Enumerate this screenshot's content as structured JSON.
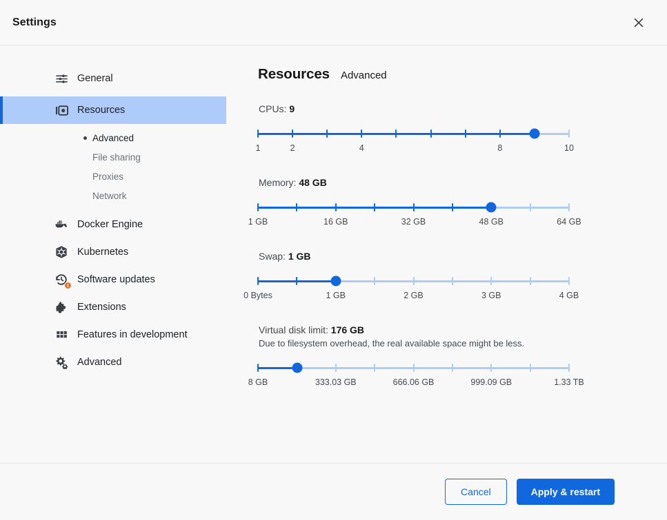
{
  "window": {
    "title": "Settings",
    "close_icon": "close-icon"
  },
  "sidebar": {
    "items": [
      {
        "label": "General",
        "icon": "tune-sliders-icon",
        "active": false
      },
      {
        "label": "Resources",
        "icon": "resources-icon",
        "active": true
      },
      {
        "label": "Docker Engine",
        "icon": "docker-whale-icon",
        "active": false
      },
      {
        "label": "Kubernetes",
        "icon": "kubernetes-helm-icon",
        "active": false
      },
      {
        "label": "Software updates",
        "icon": "update-history-icon",
        "active": false,
        "badge": "alert"
      },
      {
        "label": "Extensions",
        "icon": "puzzle-piece-icon",
        "active": false
      },
      {
        "label": "Features in development",
        "icon": "grid-blocks-icon",
        "active": false
      },
      {
        "label": "Advanced",
        "icon": "gears-icon",
        "active": false
      }
    ],
    "subitems": [
      {
        "label": "Advanced",
        "selected": true
      },
      {
        "label": "File sharing",
        "selected": false
      },
      {
        "label": "Proxies",
        "selected": false
      },
      {
        "label": "Network",
        "selected": false
      }
    ]
  },
  "main": {
    "title": "Resources",
    "subtitle": "Advanced",
    "sliders": [
      {
        "name": "cpus",
        "label_prefix": "CPUs:",
        "value_text": "9",
        "hint": "",
        "tick_count": 10,
        "thumb_index": 8,
        "thumb_percent": 88.9,
        "scale": [
          {
            "text": "1",
            "percent": 0
          },
          {
            "text": "2",
            "percent": 11.1
          },
          {
            "text": "4",
            "percent": 33.3
          },
          {
            "text": "8",
            "percent": 77.8
          },
          {
            "text": "10",
            "percent": 100
          }
        ]
      },
      {
        "name": "memory",
        "label_prefix": "Memory:",
        "value_text": "48 GB",
        "hint": "",
        "tick_count": 9,
        "thumb_index": 6,
        "thumb_percent": 75,
        "scale": [
          {
            "text": "1 GB",
            "percent": 0
          },
          {
            "text": "16 GB",
            "percent": 25
          },
          {
            "text": "32 GB",
            "percent": 50
          },
          {
            "text": "48 GB",
            "percent": 75
          },
          {
            "text": "64 GB",
            "percent": 100
          }
        ]
      },
      {
        "name": "swap",
        "label_prefix": "Swap:",
        "value_text": "1 GB",
        "hint": "",
        "tick_count": 9,
        "thumb_index": 2,
        "thumb_percent": 25,
        "scale": [
          {
            "text": "0 Bytes",
            "percent": 0
          },
          {
            "text": "1 GB",
            "percent": 25
          },
          {
            "text": "2 GB",
            "percent": 50
          },
          {
            "text": "3 GB",
            "percent": 75
          },
          {
            "text": "4 GB",
            "percent": 100
          }
        ]
      },
      {
        "name": "virtual-disk-limit",
        "label_prefix": "Virtual disk limit:",
        "value_text": "176 GB",
        "hint": "Due to filesystem overhead, the real available space might be less.",
        "tick_count": 9,
        "thumb_index": 1,
        "thumb_percent": 12.6,
        "scale": [
          {
            "text": "8 GB",
            "percent": 0
          },
          {
            "text": "333.03 GB",
            "percent": 25
          },
          {
            "text": "666.06 GB",
            "percent": 50
          },
          {
            "text": "999.09 GB",
            "percent": 75
          },
          {
            "text": "1.33 TB",
            "percent": 100
          }
        ]
      }
    ]
  },
  "footer": {
    "cancel_label": "Cancel",
    "apply_label": "Apply & restart"
  },
  "colors": {
    "accent": "#1168dd",
    "track_inactive": "#aecdf4",
    "active_nav_bg": "#aecbfa",
    "badge_orange": "#e8762a",
    "background": "#f8f8f8"
  }
}
